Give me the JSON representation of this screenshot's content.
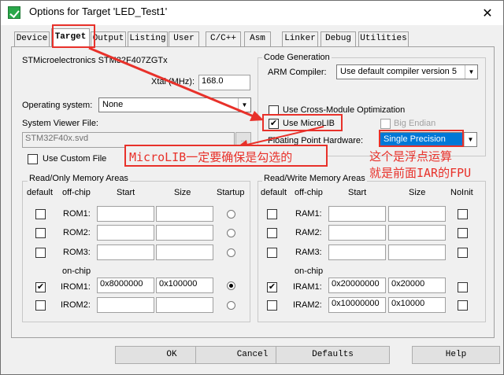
{
  "window": {
    "title": "Options for Target 'LED_Test1'",
    "close_glyph": "✕"
  },
  "tabs": [
    "Device",
    "Target",
    "Output",
    "Listing",
    "User",
    "C/C++",
    "Asm",
    "Linker",
    "Debug",
    "Utilities"
  ],
  "active_tab": "Target",
  "target": {
    "device_name": "STMicroelectronics STM32F407ZGTx",
    "xtal_label": "Xtal (MHz):",
    "xtal_value": "168.0",
    "os_label": "Operating system:",
    "os_value": "None",
    "svd_label": "System Viewer File:",
    "svd_value": "STM32F40x.svd",
    "custom_file_label": "Use Custom File"
  },
  "code_generation": {
    "title": "Code Generation",
    "compiler_label": "ARM Compiler:",
    "compiler_value": "Use default compiler version 5",
    "cross_module_label": "Use Cross-Module Optimization",
    "microlib_label": "Use MicroLIB",
    "microlib_checked": "✔",
    "big_endian_label": "Big Endian",
    "fpu_label": "Floating Point Hardware:",
    "fpu_value": "Single Precision"
  },
  "ro_memory": {
    "title": "Read/Only Memory Areas",
    "headers": {
      "default": "default",
      "offchip": "off-chip",
      "start": "Start",
      "size": "Size",
      "startup": "Startup"
    },
    "onchip_label": "on-chip",
    "rows": [
      {
        "name": "ROM1:",
        "checked": "",
        "start": "",
        "size": ""
      },
      {
        "name": "ROM2:",
        "checked": "",
        "start": "",
        "size": ""
      },
      {
        "name": "ROM3:",
        "checked": "",
        "start": "",
        "size": ""
      },
      {
        "name": "IROM1:",
        "checked": "✔",
        "start": "0x8000000",
        "size": "0x100000"
      },
      {
        "name": "IROM2:",
        "checked": "",
        "start": "",
        "size": ""
      }
    ]
  },
  "rw_memory": {
    "title": "Read/Write Memory Areas",
    "headers": {
      "default": "default",
      "offchip": "off-chip",
      "start": "Start",
      "size": "Size",
      "noinit": "NoInit"
    },
    "onchip_label": "on-chip",
    "rows": [
      {
        "name": "RAM1:",
        "checked": "",
        "start": "",
        "size": ""
      },
      {
        "name": "RAM2:",
        "checked": "",
        "start": "",
        "size": ""
      },
      {
        "name": "RAM3:",
        "checked": "",
        "start": "",
        "size": ""
      },
      {
        "name": "IRAM1:",
        "checked": "✔",
        "start": "0x20000000",
        "size": "0x20000"
      },
      {
        "name": "IRAM2:",
        "checked": "",
        "start": "0x10000000",
        "size": "0x10000"
      }
    ]
  },
  "buttons": {
    "ok": "OK",
    "cancel": "Cancel",
    "defaults": "Defaults",
    "help": "Help"
  },
  "annotations": {
    "microlib_note": "MicroLIB一定要确保是勾选的",
    "fpu_note_line1": "这个是浮点运算",
    "fpu_note_line2": "就是前面IAR的FPU",
    "color": "#e8312a"
  }
}
